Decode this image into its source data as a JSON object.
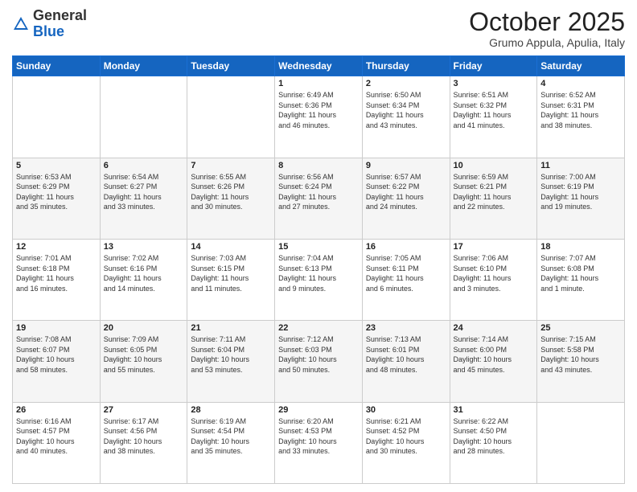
{
  "header": {
    "logo": {
      "general": "General",
      "blue": "Blue"
    },
    "title": "October 2025",
    "subtitle": "Grumo Appula, Apulia, Italy"
  },
  "calendar": {
    "days_of_week": [
      "Sunday",
      "Monday",
      "Tuesday",
      "Wednesday",
      "Thursday",
      "Friday",
      "Saturday"
    ],
    "weeks": [
      [
        {
          "day": "",
          "info": ""
        },
        {
          "day": "",
          "info": ""
        },
        {
          "day": "",
          "info": ""
        },
        {
          "day": "1",
          "info": "Sunrise: 6:49 AM\nSunset: 6:36 PM\nDaylight: 11 hours\nand 46 minutes."
        },
        {
          "day": "2",
          "info": "Sunrise: 6:50 AM\nSunset: 6:34 PM\nDaylight: 11 hours\nand 43 minutes."
        },
        {
          "day": "3",
          "info": "Sunrise: 6:51 AM\nSunset: 6:32 PM\nDaylight: 11 hours\nand 41 minutes."
        },
        {
          "day": "4",
          "info": "Sunrise: 6:52 AM\nSunset: 6:31 PM\nDaylight: 11 hours\nand 38 minutes."
        }
      ],
      [
        {
          "day": "5",
          "info": "Sunrise: 6:53 AM\nSunset: 6:29 PM\nDaylight: 11 hours\nand 35 minutes."
        },
        {
          "day": "6",
          "info": "Sunrise: 6:54 AM\nSunset: 6:27 PM\nDaylight: 11 hours\nand 33 minutes."
        },
        {
          "day": "7",
          "info": "Sunrise: 6:55 AM\nSunset: 6:26 PM\nDaylight: 11 hours\nand 30 minutes."
        },
        {
          "day": "8",
          "info": "Sunrise: 6:56 AM\nSunset: 6:24 PM\nDaylight: 11 hours\nand 27 minutes."
        },
        {
          "day": "9",
          "info": "Sunrise: 6:57 AM\nSunset: 6:22 PM\nDaylight: 11 hours\nand 24 minutes."
        },
        {
          "day": "10",
          "info": "Sunrise: 6:59 AM\nSunset: 6:21 PM\nDaylight: 11 hours\nand 22 minutes."
        },
        {
          "day": "11",
          "info": "Sunrise: 7:00 AM\nSunset: 6:19 PM\nDaylight: 11 hours\nand 19 minutes."
        }
      ],
      [
        {
          "day": "12",
          "info": "Sunrise: 7:01 AM\nSunset: 6:18 PM\nDaylight: 11 hours\nand 16 minutes."
        },
        {
          "day": "13",
          "info": "Sunrise: 7:02 AM\nSunset: 6:16 PM\nDaylight: 11 hours\nand 14 minutes."
        },
        {
          "day": "14",
          "info": "Sunrise: 7:03 AM\nSunset: 6:15 PM\nDaylight: 11 hours\nand 11 minutes."
        },
        {
          "day": "15",
          "info": "Sunrise: 7:04 AM\nSunset: 6:13 PM\nDaylight: 11 hours\nand 9 minutes."
        },
        {
          "day": "16",
          "info": "Sunrise: 7:05 AM\nSunset: 6:11 PM\nDaylight: 11 hours\nand 6 minutes."
        },
        {
          "day": "17",
          "info": "Sunrise: 7:06 AM\nSunset: 6:10 PM\nDaylight: 11 hours\nand 3 minutes."
        },
        {
          "day": "18",
          "info": "Sunrise: 7:07 AM\nSunset: 6:08 PM\nDaylight: 11 hours\nand 1 minute."
        }
      ],
      [
        {
          "day": "19",
          "info": "Sunrise: 7:08 AM\nSunset: 6:07 PM\nDaylight: 10 hours\nand 58 minutes."
        },
        {
          "day": "20",
          "info": "Sunrise: 7:09 AM\nSunset: 6:05 PM\nDaylight: 10 hours\nand 55 minutes."
        },
        {
          "day": "21",
          "info": "Sunrise: 7:11 AM\nSunset: 6:04 PM\nDaylight: 10 hours\nand 53 minutes."
        },
        {
          "day": "22",
          "info": "Sunrise: 7:12 AM\nSunset: 6:03 PM\nDaylight: 10 hours\nand 50 minutes."
        },
        {
          "day": "23",
          "info": "Sunrise: 7:13 AM\nSunset: 6:01 PM\nDaylight: 10 hours\nand 48 minutes."
        },
        {
          "day": "24",
          "info": "Sunrise: 7:14 AM\nSunset: 6:00 PM\nDaylight: 10 hours\nand 45 minutes."
        },
        {
          "day": "25",
          "info": "Sunrise: 7:15 AM\nSunset: 5:58 PM\nDaylight: 10 hours\nand 43 minutes."
        }
      ],
      [
        {
          "day": "26",
          "info": "Sunrise: 6:16 AM\nSunset: 4:57 PM\nDaylight: 10 hours\nand 40 minutes."
        },
        {
          "day": "27",
          "info": "Sunrise: 6:17 AM\nSunset: 4:56 PM\nDaylight: 10 hours\nand 38 minutes."
        },
        {
          "day": "28",
          "info": "Sunrise: 6:19 AM\nSunset: 4:54 PM\nDaylight: 10 hours\nand 35 minutes."
        },
        {
          "day": "29",
          "info": "Sunrise: 6:20 AM\nSunset: 4:53 PM\nDaylight: 10 hours\nand 33 minutes."
        },
        {
          "day": "30",
          "info": "Sunrise: 6:21 AM\nSunset: 4:52 PM\nDaylight: 10 hours\nand 30 minutes."
        },
        {
          "day": "31",
          "info": "Sunrise: 6:22 AM\nSunset: 4:50 PM\nDaylight: 10 hours\nand 28 minutes."
        },
        {
          "day": "",
          "info": ""
        }
      ]
    ]
  }
}
